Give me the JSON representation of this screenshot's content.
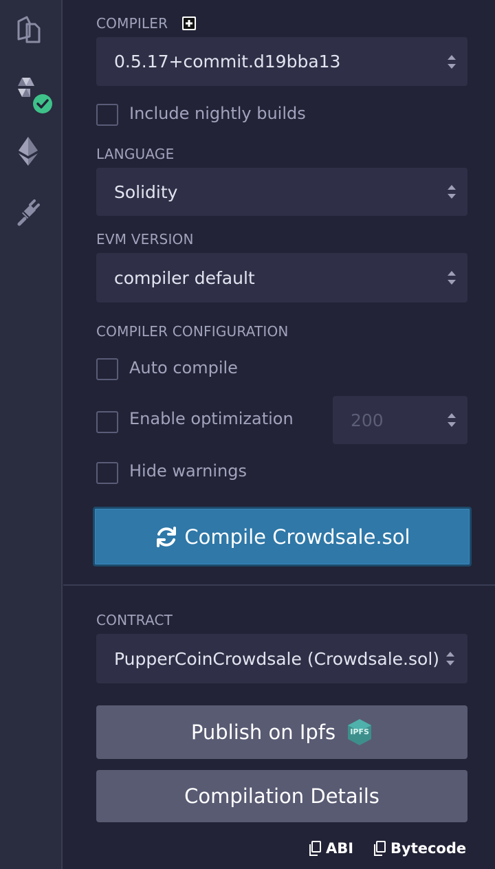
{
  "compiler": {
    "label": "COMPILER",
    "version": "0.5.17+commit.d19bba13",
    "nightly_label": "Include nightly builds"
  },
  "language": {
    "label": "LANGUAGE",
    "value": "Solidity"
  },
  "evm": {
    "label": "EVM VERSION",
    "value": "compiler default"
  },
  "config": {
    "label": "COMPILER CONFIGURATION",
    "auto_compile": "Auto compile",
    "optimization": "Enable optimization",
    "runs": "200",
    "hide_warnings": "Hide warnings"
  },
  "compile_button": "Compile Crowdsale.sol",
  "contract": {
    "label": "CONTRACT",
    "value": "PupperCoinCrowdsale (Crowdsale.sol)"
  },
  "publish_button": "Publish on Ipfs",
  "ipfs_badge": "IPFS",
  "details_button": "Compilation Details",
  "abi_label": "ABI",
  "bytecode_label": "Bytecode",
  "colors": {
    "background": "#222336",
    "sidebar": "#2a2c3f",
    "primary": "#2f78a8",
    "secondary": "#595b73",
    "success": "#3ec28a"
  },
  "icons": [
    "file-manager-icon",
    "solidity-compiler-icon",
    "deploy-icon",
    "plugin-manager-icon",
    "plus-box-icon",
    "sync-icon",
    "ipfs-icon",
    "copy-icon"
  ]
}
